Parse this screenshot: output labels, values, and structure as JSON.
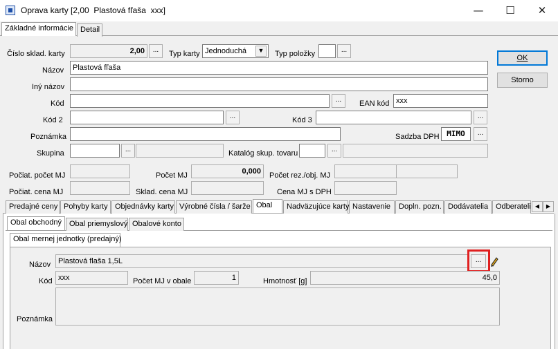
{
  "window": {
    "title": "Oprava karty [2,00  Plastová fľaša  xxx]",
    "minimize_glyph": "—",
    "maximize_glyph": "☐",
    "close_glyph": "✕"
  },
  "top_tabs": [
    "Základné informácie",
    "Detail"
  ],
  "form": {
    "cislo_karty_label": "Číslo sklad. karty",
    "cislo_karty_value": "2,00",
    "typ_karty_label": "Typ karty",
    "typ_karty_value": "Jednoduchá",
    "typ_polozky_label": "Typ položky",
    "typ_polozky_value": "",
    "nazov_label": "Názov",
    "nazov_value": "Plastová fľaša",
    "iny_nazov_label": "Iný názov",
    "iny_nazov_value": "",
    "kod_label": "Kód",
    "kod_value": "",
    "ean_label": "EAN kód",
    "ean_value": "xxx",
    "kod2_label": "Kód 2",
    "kod2_value": "",
    "kod3_label": "Kód 3",
    "kod3_value": "",
    "poznamka_label": "Poznámka",
    "poznamka_value": "",
    "sadzba_label": "Sadzba DPH",
    "sadzba_value": "MIMO",
    "skupina_label": "Skupina",
    "skupina_code": "",
    "skupina_name": "",
    "katalog_label": "Katalóg skup. tovaru",
    "katalog_code": "",
    "katalog_name": "",
    "dots": "..."
  },
  "stats": {
    "pociat_pocet_label": "Počiat. počet MJ",
    "pociat_pocet_value": "",
    "pocet_label": "Počet MJ",
    "pocet_value": "0,000",
    "pocet_rez_label": "Počet rez./obj. MJ",
    "pocet_rez_value1": "",
    "pocet_rez_value2": "",
    "pociat_cena_label": "Počiat. cena MJ",
    "pociat_cena_value": "",
    "sklad_cena_label": "Sklad. cena MJ",
    "sklad_cena_value": "",
    "cena_dph_label": "Cena MJ s DPH",
    "cena_dph_value": ""
  },
  "buttons": {
    "ok": "OK",
    "storno": "Storno"
  },
  "detail_tabs": [
    "Predajné ceny",
    "Pohyby karty",
    "Objednávky karty",
    "Výrobné čísla / šarže",
    "Obal",
    "Nadväzujúce karty",
    "Nastavenie",
    "Dopln. pozn.",
    "Dodávatelia",
    "Odberateli"
  ],
  "obal_tabs": [
    "Obal obchodný",
    "Obal priemyslový",
    "Obalové konto"
  ],
  "obal_subtab": "Obal mernej jednotky (predajný)",
  "obal": {
    "nazov_label": "Názov",
    "nazov_value": "Plastová flaša 1,5L",
    "kod_label": "Kód",
    "kod_value": "xxx",
    "pocet_label": "Počet MJ v obale",
    "pocet_value": "1",
    "hmotnost_label": "Hmotnosť [g]",
    "hmotnost_value": "45,0",
    "poznamka_label": "Poznámka",
    "poznamka_value": ""
  },
  "colors": {
    "highlight": "#e02020",
    "accent": "#0078d7"
  }
}
